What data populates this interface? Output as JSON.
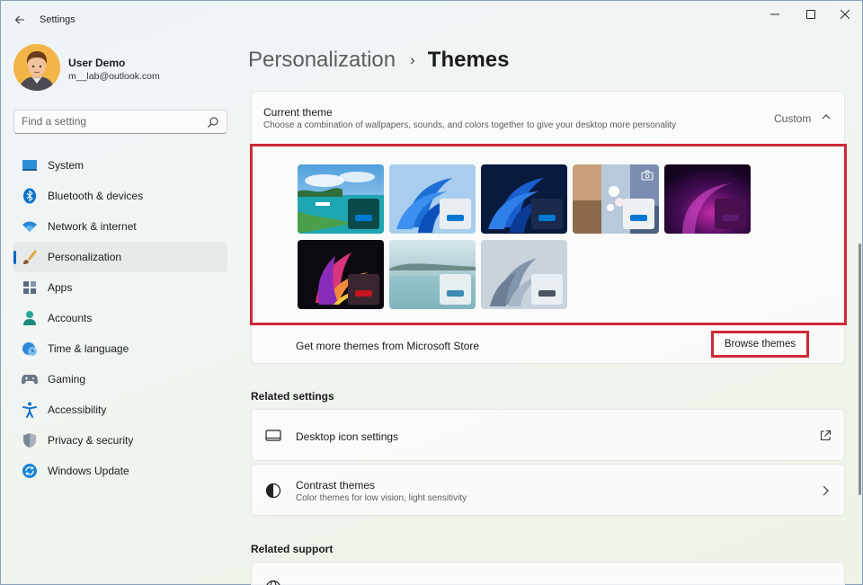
{
  "window": {
    "title": "Settings"
  },
  "user": {
    "name": "User Demo",
    "email": "m__lab@outlook.com"
  },
  "search": {
    "placeholder": "Find a setting"
  },
  "sidebar": {
    "items": [
      {
        "label": "System",
        "icon": "system-icon",
        "active": false
      },
      {
        "label": "Bluetooth & devices",
        "icon": "bluetooth-icon",
        "active": false
      },
      {
        "label": "Network & internet",
        "icon": "wifi-icon",
        "active": false
      },
      {
        "label": "Personalization",
        "icon": "brush-icon",
        "active": true
      },
      {
        "label": "Apps",
        "icon": "apps-icon",
        "active": false
      },
      {
        "label": "Accounts",
        "icon": "accounts-icon",
        "active": false
      },
      {
        "label": "Time & language",
        "icon": "globe-clock-icon",
        "active": false
      },
      {
        "label": "Gaming",
        "icon": "gamepad-icon",
        "active": false
      },
      {
        "label": "Accessibility",
        "icon": "accessibility-icon",
        "active": false
      },
      {
        "label": "Privacy & security",
        "icon": "shield-icon",
        "active": false
      },
      {
        "label": "Windows Update",
        "icon": "windows-update-icon",
        "active": false
      }
    ]
  },
  "breadcrumb": {
    "parent": "Personalization",
    "separator": "›",
    "current": "Themes"
  },
  "current_theme": {
    "title": "Current theme",
    "description": "Choose a combination of wallpapers, sounds, and colors together to give your desktop more personality",
    "value": "Custom",
    "themes": [
      {
        "name": "custom-coast",
        "accent": "#0078d4"
      },
      {
        "name": "windows-light",
        "accent": "#0078d4"
      },
      {
        "name": "windows-dark",
        "accent": "#0078d4"
      },
      {
        "name": "spotlight",
        "accent": "#0078d4"
      },
      {
        "name": "glow",
        "accent": "#5b1a6e"
      },
      {
        "name": "captured-motion",
        "accent": "#c4141f"
      },
      {
        "name": "flow",
        "accent": "#3a8bb5"
      },
      {
        "name": "sunrise",
        "accent": "#4a5561"
      }
    ]
  },
  "store": {
    "text": "Get more themes from Microsoft Store",
    "button_label": "Browse themes"
  },
  "related_settings": {
    "title": "Related settings",
    "desktop_icon": {
      "title": "Desktop icon settings"
    },
    "contrast": {
      "title": "Contrast themes",
      "subtitle": "Color themes for low vision, light sensitivity"
    }
  },
  "related_support": {
    "title": "Related support"
  },
  "colors": {
    "accent": "#0067c0",
    "highlight": "#cc2b36"
  }
}
